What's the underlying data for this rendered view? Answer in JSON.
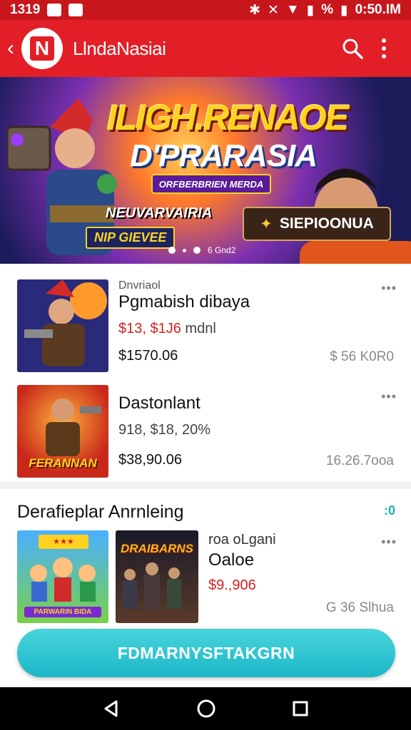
{
  "status_bar": {
    "time_left": "1319",
    "time_right": "0:50.IM",
    "battery_text": "%"
  },
  "app_bar": {
    "logo_letter": "N",
    "title": "LlndaNasiai"
  },
  "banner": {
    "title_line1": "ILIGH.RENAOE",
    "title_line2": "D'PRARASIA",
    "ribbon": "ORFBERBRIEN MERDA",
    "sub_line1": "NEUVARVAIRIA",
    "sub_line2": "NIP GIEVEE",
    "cta_label": "SIEPIOONUA",
    "pager_text": "6 Gnd2"
  },
  "games": [
    {
      "sub": "Dnvriaol",
      "title": "Pgmabish dibaya",
      "price_red": "$13, $1J6",
      "price_rest": " mdnl",
      "amount": "$1570.06",
      "right": "$ 56 K0R0"
    },
    {
      "sub": "",
      "title": "Dastonlant",
      "price_red": "",
      "price_rest": "918, $18, 20%",
      "amount": "$38,90.06",
      "right": "16.26.7ooa",
      "thumb_caption": "FERANNAN"
    }
  ],
  "section": {
    "title": "Derafieplar Anrnleing",
    "item": {
      "line1": "roa oLgani",
      "line2": "Oaloe",
      "price": "$9.,906",
      "right": "G 36 Slhua"
    },
    "thumb1_caption": "PARWARIN BIDA",
    "thumb2_caption": "DRAIBARNS"
  },
  "cta": {
    "label": "FDMARNYSFTAKGRN"
  },
  "colors": {
    "brand_red": "#e21f26",
    "accent_teal": "#1cb7c8",
    "price_red": "#d3201f"
  }
}
